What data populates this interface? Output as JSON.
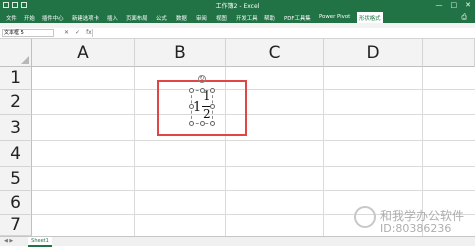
{
  "window": {
    "title": "工作簿2 - Excel",
    "controls": {
      "min": "—",
      "max": "□",
      "close": "✕"
    }
  },
  "ribbon": {
    "tabs": [
      {
        "label": "文件"
      },
      {
        "label": "开始"
      },
      {
        "label": "插件中心"
      },
      {
        "label": "新建选项卡"
      },
      {
        "label": "插入"
      },
      {
        "label": "页面布局"
      },
      {
        "label": "公式"
      },
      {
        "label": "数据"
      },
      {
        "label": "审阅"
      },
      {
        "label": "视图"
      },
      {
        "label": "开发工具"
      },
      {
        "label": "帮助"
      },
      {
        "label": "PDF工具集"
      },
      {
        "label": "Power Pivot"
      },
      {
        "label": "形状格式"
      }
    ],
    "active_tab_index": 14
  },
  "formula_bar": {
    "name_box": "文本框 5",
    "value": ""
  },
  "columns": [
    "A",
    "B",
    "C",
    "D"
  ],
  "rows": [
    "1",
    "2",
    "3",
    "4",
    "5",
    "6",
    "7"
  ],
  "equation": {
    "whole": "1",
    "numerator": "1",
    "denominator": "2"
  },
  "sheets": [
    {
      "name": "Sheet1",
      "active": true
    }
  ],
  "watermark": {
    "line1": "和我学办公软件",
    "line2": "ID:80386236"
  },
  "colors": {
    "accent": "#217346",
    "highlight_box": "#e04646",
    "gridline": "#dadada",
    "header_bg": "#f3f3f3"
  }
}
